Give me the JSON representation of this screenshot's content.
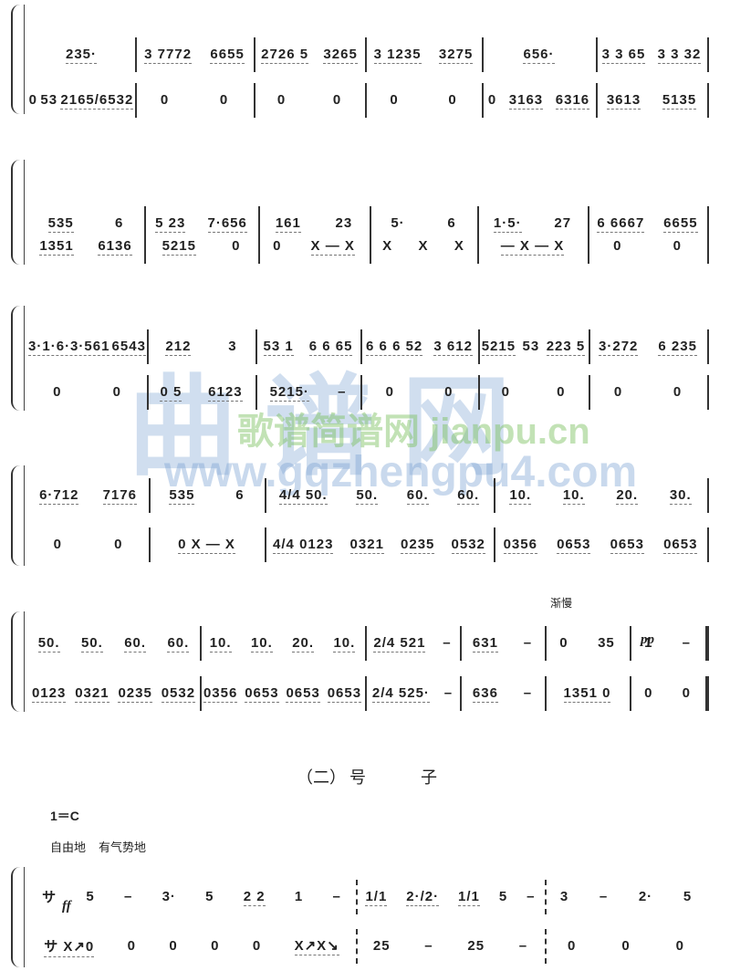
{
  "systems": [
    {
      "upper": [
        "235·",
        "3 7772  6655",
        "2726 5  3265",
        "3 1235  3275",
        "656·",
        "3 3 65   3 3 32"
      ],
      "lower": [
        "0  53  2165/6532",
        "0   0",
        "0   0",
        "0   0",
        "0  3163  6316",
        "3613  5135"
      ]
    },
    {
      "upper": [
        "535   6",
        "5 23  7·656",
        "161   23",
        "5·   6",
        "1·5·   27",
        "6 6667  6655"
      ],
      "lower": [
        "1351  6136",
        "5215   0",
        "0  X — X",
        "X  X  X",
        "— X — X",
        "0   0"
      ]
    },
    {
      "upper": [
        "3·1·6·3·561  6543",
        "212   3",
        "53 1  6 6 65",
        "6 6 6 52  3 612",
        "5215  53  223 5",
        "3·272  6 235"
      ],
      "lower": [
        "0   0",
        "0 5   6123",
        "5215·   –",
        "0   0",
        "0   0",
        "0   0"
      ]
    },
    {
      "upper": [
        "6·712  7176",
        "535   6",
        "4/4 50.  50.  60.  60.",
        "10.  10.  20.  30."
      ],
      "lower": [
        "0   0",
        "0 X — X",
        "4/4 0123  0321  0235  0532",
        "0356  0653  0653  0653"
      ]
    },
    {
      "upper": [
        "50.  50.  60.  60.",
        "10.  10.  20.  10.",
        "2/4 521   –",
        "631   –",
        "0   35",
        "1   –"
      ],
      "lower": [
        "0123  0321  0235  0532",
        "0356  0653  0653  0653",
        "2/4 525·   –",
        "636   –",
        "1351 0",
        "0   0"
      ]
    },
    {
      "upper": [
        "サ  5   –   3·  5  2 2  1   –",
        "1/1   2·/2·  1/1  5   –",
        "3   –   2·  5"
      ],
      "lower": [
        "サ X↗0   0   0   0   0   X↗X↘",
        "25   –   25   –",
        "0   0   0"
      ]
    }
  ],
  "annotations": {
    "rit": "渐慢",
    "pp": "pp",
    "ff": "ff"
  },
  "section": {
    "number": "（二）",
    "title_1": "号",
    "title_2": "子"
  },
  "key": "1＝C",
  "tempo": [
    "自由地",
    "有气势地"
  ],
  "watermark": {
    "chars": "曲谱网",
    "url": "www.gqzhengpu4.com",
    "green": "歌谱简谱网 jianpu.cn"
  }
}
